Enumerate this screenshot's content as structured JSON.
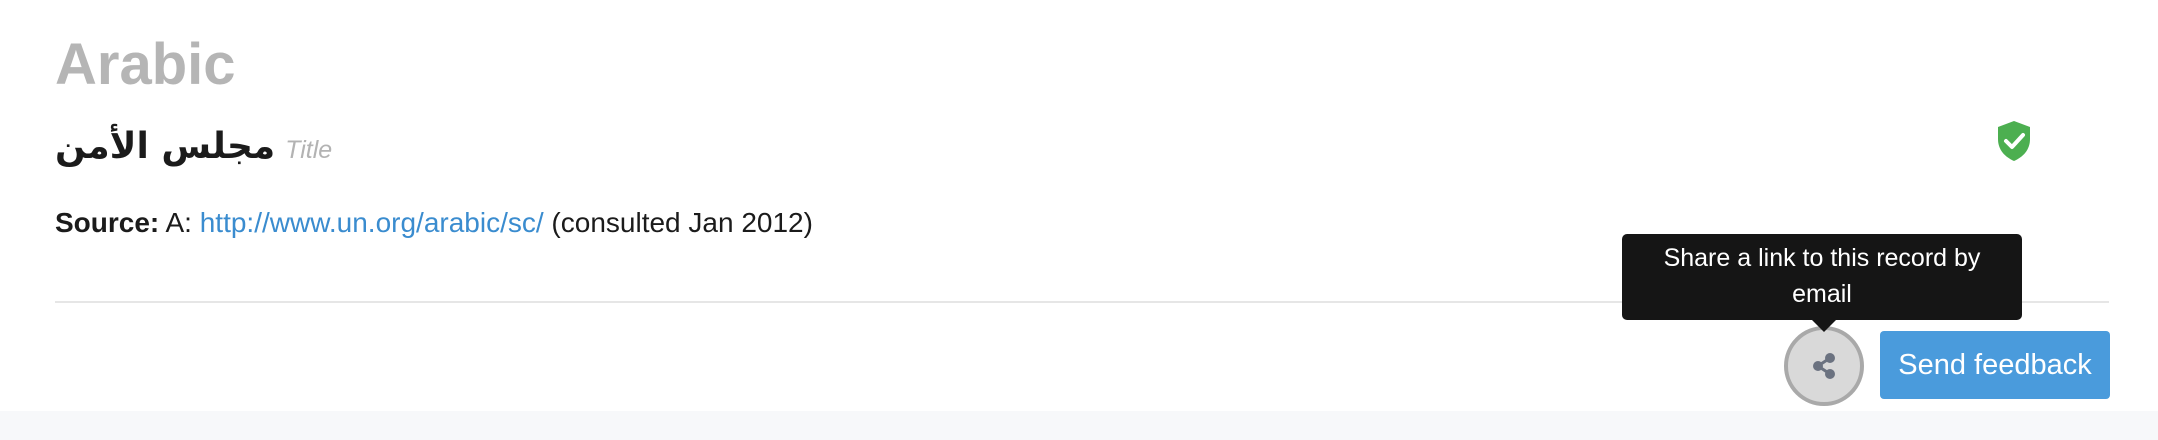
{
  "record": {
    "language": "Arabic",
    "term": "مجلس الأمن",
    "term_type": "Title",
    "source": {
      "label": "Source:",
      "prefix": " A: ",
      "link_text": "http://www.un.org/arabic/sc/",
      "suffix": " (consulted Jan 2012)"
    },
    "verified_icon": "shield-check-icon"
  },
  "actions": {
    "share_icon": "share-icon",
    "share_tooltip": "Share a link to this record by email",
    "feedback_label": "Send feedback"
  },
  "colors": {
    "heading": "#b5b5b5",
    "link": "#3a8ccf",
    "verified": "#4caf50",
    "feedback_button": "#4a9bdc",
    "tooltip_bg": "#151515"
  }
}
